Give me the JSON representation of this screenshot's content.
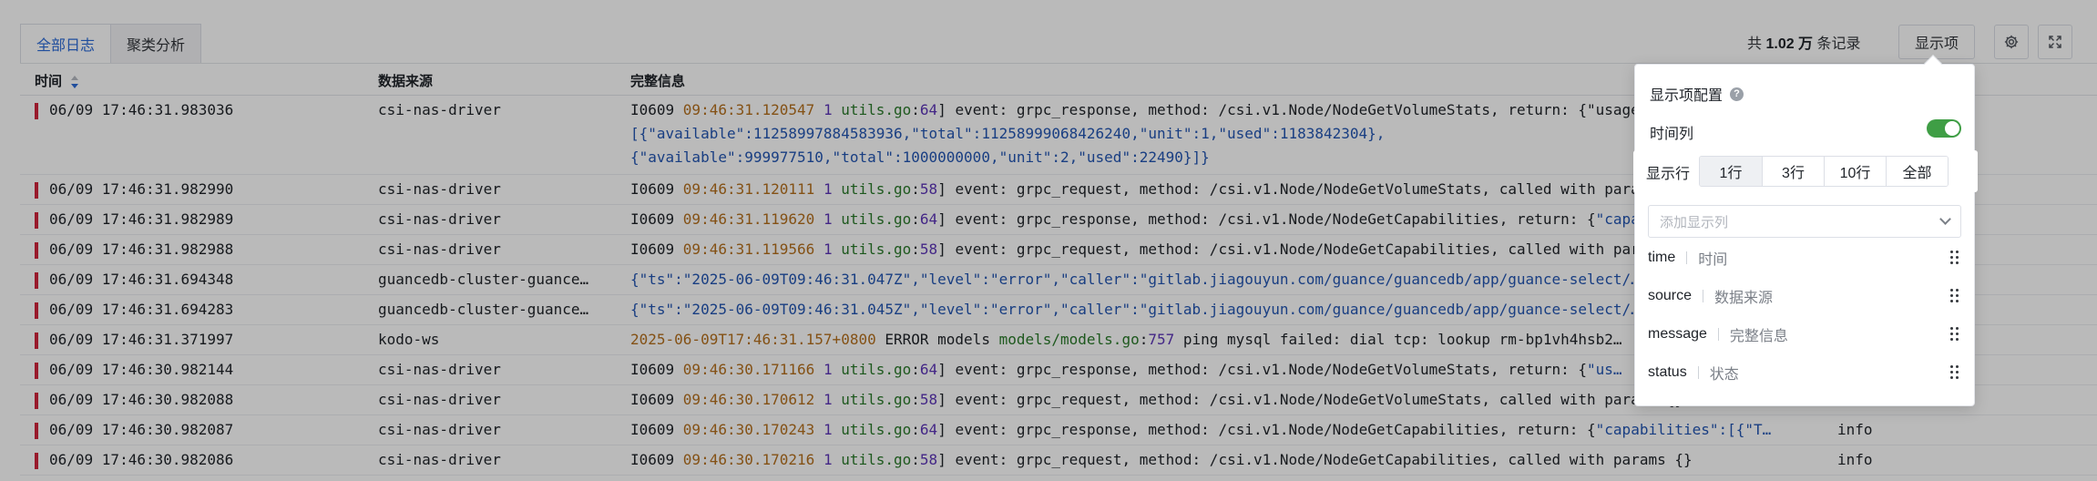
{
  "tabs": [
    {
      "label": "全部日志",
      "active": true
    },
    {
      "label": "聚类分析",
      "active": false
    }
  ],
  "toolbar": {
    "record_prefix": "共",
    "record_count": "1.02 万",
    "record_suffix": "条记录",
    "display_button": "显示项",
    "gear_icon": "gear-icon",
    "expand_icon": "fullscreen-icon"
  },
  "columns": {
    "time": "时间",
    "source": "数据来源",
    "message": "完整信息"
  },
  "rows": [
    {
      "time": "06/09 17:46:31.983036",
      "source": "csi-nas-driver",
      "msg_parts": [
        [
          "",
          "I0609 "
        ],
        [
          "ts",
          "09:46:31.120547"
        ],
        [
          "",
          "       "
        ],
        [
          "num",
          "1"
        ],
        [
          "",
          " "
        ],
        [
          "file",
          "utils.go"
        ],
        [
          "",
          ":"
        ],
        [
          "num",
          "64"
        ],
        [
          "",
          "] event: grpc_response, method: /csi.v1.Node/NodeGetVolumeStats, return: {\"usage\":"
        ]
      ],
      "msg_extra": [
        "[{\"available\":11258997884583936,\"total\":11258999068426240,\"unit\":1,\"used\":1183842304},",
        "{\"available\":999977510,\"total\":1000000000,\"unit\":2,\"used\":22490}]}"
      ],
      "status": ""
    },
    {
      "time": "06/09 17:46:31.982990",
      "source": "csi-nas-driver",
      "msg_parts": [
        [
          "",
          "I0609 "
        ],
        [
          "ts",
          "09:46:31.120111"
        ],
        [
          "",
          " "
        ],
        [
          "num",
          "1"
        ],
        [
          "",
          " "
        ],
        [
          "file",
          "utils.go"
        ],
        [
          "",
          ":"
        ],
        [
          "num",
          "58"
        ],
        [
          "",
          "] event: grpc_request, method: /csi.v1.Node/NodeGetVolumeStats, called with params {}"
        ]
      ],
      "status": ""
    },
    {
      "time": "06/09 17:46:31.982989",
      "source": "csi-nas-driver",
      "msg_parts": [
        [
          "",
          "I0609 "
        ],
        [
          "ts",
          "09:46:31.119620"
        ],
        [
          "",
          " "
        ],
        [
          "num",
          "1"
        ],
        [
          "",
          " "
        ],
        [
          "file",
          "utils.go"
        ],
        [
          "",
          ":"
        ],
        [
          "num",
          "64"
        ],
        [
          "",
          "] event: grpc_response, method: /csi.v1.Node/NodeGetCapabilities, return: {"
        ],
        [
          "json",
          "\"capabilities\":[{\"T…"
        ]
      ],
      "status": ""
    },
    {
      "time": "06/09 17:46:31.982988",
      "source": "csi-nas-driver",
      "msg_parts": [
        [
          "",
          "I0609 "
        ],
        [
          "ts",
          "09:46:31.119566"
        ],
        [
          "",
          " "
        ],
        [
          "num",
          "1"
        ],
        [
          "",
          " "
        ],
        [
          "file",
          "utils.go"
        ],
        [
          "",
          ":"
        ],
        [
          "num",
          "58"
        ],
        [
          "",
          "] event: grpc_request, method: /csi.v1.Node/NodeGetCapabilities, called with params {}"
        ]
      ],
      "status": ""
    },
    {
      "time": "06/09 17:46:31.694348",
      "source": "guancedb-cluster-guance…",
      "msg_parts": [
        [
          "json",
          "{\"ts\":\"2025-06-09T09:46:31.047Z\",\"level\":\"error\",\"caller\":\"gitlab.jiagouyun.com/guance/guancedb/app/guance-select/…"
        ]
      ],
      "status": ""
    },
    {
      "time": "06/09 17:46:31.694283",
      "source": "guancedb-cluster-guance…",
      "msg_parts": [
        [
          "json",
          "{\"ts\":\"2025-06-09T09:46:31.045Z\",\"level\":\"error\",\"caller\":\"gitlab.jiagouyun.com/guance/guancedb/app/guance-select/…"
        ]
      ],
      "status": ""
    },
    {
      "time": "06/09 17:46:31.371997",
      "source": "kodo-ws",
      "msg_parts": [
        [
          "ts",
          "2025-06-09T17:46:31.157+0800"
        ],
        [
          "",
          " ERROR models "
        ],
        [
          "file",
          "models/models.go"
        ],
        [
          "",
          ":"
        ],
        [
          "num",
          "757"
        ],
        [
          "",
          " ping mysql failed: dial tcp: lookup rm-bp1vh4hsb2…"
        ]
      ],
      "status": ""
    },
    {
      "time": "06/09 17:46:30.982144",
      "source": "csi-nas-driver",
      "msg_parts": [
        [
          "",
          "I0609 "
        ],
        [
          "ts",
          "09:46:30.171166"
        ],
        [
          "",
          " "
        ],
        [
          "num",
          "1"
        ],
        [
          "",
          " "
        ],
        [
          "file",
          "utils.go"
        ],
        [
          "",
          ":"
        ],
        [
          "num",
          "64"
        ],
        [
          "",
          "] event: grpc_response, method: /csi.v1.Node/NodeGetVolumeStats, return: {"
        ],
        [
          "json",
          "\"us…"
        ]
      ],
      "status": ""
    },
    {
      "time": "06/09 17:46:30.982088",
      "source": "csi-nas-driver",
      "msg_parts": [
        [
          "",
          "I0609 "
        ],
        [
          "ts",
          "09:46:30.170612"
        ],
        [
          "",
          " "
        ],
        [
          "num",
          "1"
        ],
        [
          "",
          " "
        ],
        [
          "file",
          "utils.go"
        ],
        [
          "",
          ":"
        ],
        [
          "num",
          "58"
        ],
        [
          "",
          "] event: grpc_request, method: /csi.v1.Node/NodeGetVolumeStats, called with params {}"
        ]
      ],
      "status": ""
    },
    {
      "time": "06/09 17:46:30.982087",
      "source": "csi-nas-driver",
      "msg_parts": [
        [
          "",
          "I0609 "
        ],
        [
          "ts",
          "09:46:30.170243"
        ],
        [
          "",
          " "
        ],
        [
          "num",
          "1"
        ],
        [
          "",
          " "
        ],
        [
          "file",
          "utils.go"
        ],
        [
          "",
          ":"
        ],
        [
          "num",
          "64"
        ],
        [
          "",
          "] event: grpc_response, method: /csi.v1.Node/NodeGetCapabilities, return: {"
        ],
        [
          "json",
          "\"capabilities\":[{\"T…"
        ]
      ],
      "status": "info"
    },
    {
      "time": "06/09 17:46:30.982086",
      "source": "csi-nas-driver",
      "msg_parts": [
        [
          "",
          "I0609 "
        ],
        [
          "ts",
          "09:46:30.170216"
        ],
        [
          "",
          " "
        ],
        [
          "num",
          "1"
        ],
        [
          "",
          " "
        ],
        [
          "file",
          "utils.go"
        ],
        [
          "",
          ":"
        ],
        [
          "num",
          "58"
        ],
        [
          "",
          "] event: grpc_request, method: /csi.v1.Node/NodeGetCapabilities, called with params {}"
        ]
      ],
      "status": "info"
    }
  ],
  "panel": {
    "title": "显示项配置",
    "help_glyph": "?",
    "time_column_label": "时间列",
    "time_column_enabled": true,
    "lines_label": "显示行",
    "lines_options": [
      "1行",
      "3行",
      "10行",
      "全部"
    ],
    "lines_selected": "1行",
    "add_placeholder": "添加显示列",
    "columns": [
      {
        "key": "time",
        "label": "时间"
      },
      {
        "key": "source",
        "label": "数据来源"
      },
      {
        "key": "message",
        "label": "完整信息"
      },
      {
        "key": "status",
        "label": "状态"
      }
    ]
  },
  "colors": {
    "accent": "#2d6bd8",
    "error_bar": "#d1243b",
    "toggle_on": "#3f9e45"
  }
}
